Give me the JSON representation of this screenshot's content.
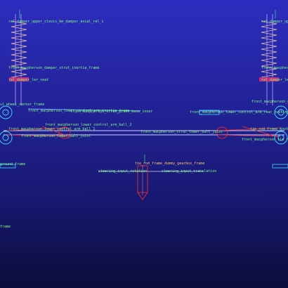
{
  "labels": {
    "damper_top_left": "ral_damper_upper_clevis_bm_damper_axial_rel_i",
    "damper_top_right": "ral_damper_upper_clev",
    "inertia_left": "front_macpherson_damper_strut_inertia_frame",
    "inertia_right": "front_macpherson_strut",
    "lower_seat_left": "ral_damper_lwr_seat",
    "lower_seat_right": "ral_damper_lwr_seat",
    "wheel_center_left": "ul_wheel_center_frame",
    "wheel_center_right": "front_macpherson_upr_ll",
    "control_arm_frame": "front_macpherson_lower_control_arm_inertia_frame",
    "strut_inner": "front_macpherson_strut_pivot_base_inner",
    "lower_ball_left": "front_macpherson_lower_control_arm_ball_2",
    "lower_ball_right": "front_macpherson_strut_lower_ball_joint",
    "ca_left_1": "front_macpherson_lower_control_arm_ball_1",
    "ca_left_2": "front_macpherson_lower_ball_joint",
    "ca_right": "front_macpherson_lower_control_arm_rear_bushing",
    "frame_right": "tie_rod_frame_knot",
    "steer_frame": "tie_rod_frame_dummy_gearbox_frame",
    "steer_input_left": "steering_input_rotation",
    "steer_input_right": "steering_input_translation",
    "frame_far_right": "front_macpherson_tie_rod",
    "left_edge_1": "ground_frame",
    "left_edge_2": "frame"
  },
  "colors": {
    "bg_top": "#2d2dbf",
    "bg_bottom": "#0c0c3a",
    "label": "#7dff7d",
    "coil": "#e8c8a0",
    "ring": "#40e0ff",
    "axis": "#ff3030"
  }
}
